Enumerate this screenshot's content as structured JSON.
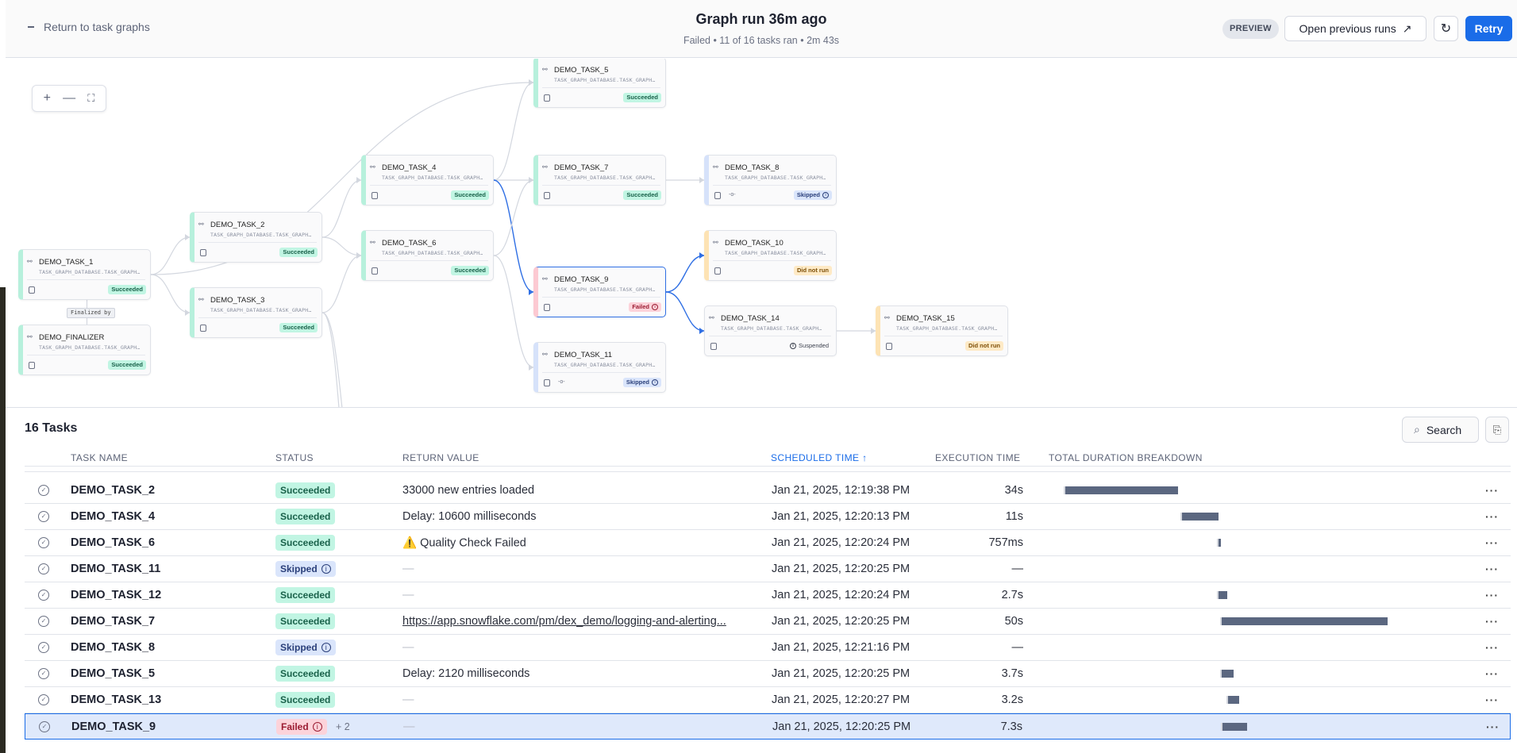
{
  "header": {
    "back_label": "Return to task graphs",
    "title": "Graph run 36m ago",
    "subtitle": "Failed • 11 of 16 tasks ran • 2m 43s",
    "preview_badge": "PREVIEW",
    "open_previous_runs": "Open previous runs",
    "retry": "Retry"
  },
  "graph": {
    "zoom_in": "+",
    "zoom_out": "—",
    "fit": "⛶",
    "finalized_by": "Finalized by",
    "subtitle": "TASK_GRAPH_DATABASE.TASK_GRAPH…",
    "nodes": [
      {
        "name": "DEMO_TASK_1",
        "status": "Succeeded",
        "kind": "succeeded"
      },
      {
        "name": "DEMO_FINALIZER",
        "status": "Succeeded",
        "kind": "succeeded"
      },
      {
        "name": "DEMO_TASK_2",
        "status": "Succeeded",
        "kind": "succeeded"
      },
      {
        "name": "DEMO_TASK_3",
        "status": "Succeeded",
        "kind": "succeeded"
      },
      {
        "name": "DEMO_TASK_4",
        "status": "Succeeded",
        "kind": "succeeded"
      },
      {
        "name": "DEMO_TASK_6",
        "status": "Succeeded",
        "kind": "succeeded"
      },
      {
        "name": "DEMO_TASK_5",
        "status": "Succeeded",
        "kind": "succeeded"
      },
      {
        "name": "DEMO_TASK_7",
        "status": "Succeeded",
        "kind": "succeeded"
      },
      {
        "name": "DEMO_TASK_9",
        "status": "Failed",
        "kind": "failed",
        "selected": true
      },
      {
        "name": "DEMO_TASK_11",
        "status": "Skipped",
        "kind": "skipped"
      },
      {
        "name": "DEMO_TASK_8",
        "status": "Skipped",
        "kind": "skipped"
      },
      {
        "name": "DEMO_TASK_10",
        "status": "Did not run",
        "kind": "didnotrun"
      },
      {
        "name": "DEMO_TASK_14",
        "status": "Suspended",
        "kind": "suspended"
      },
      {
        "name": "DEMO_TASK_15",
        "status": "Did not run",
        "kind": "didnotrun"
      }
    ],
    "edges": [
      [
        "DEMO_TASK_1",
        "DEMO_TASK_2"
      ],
      [
        "DEMO_TASK_1",
        "DEMO_TASK_3"
      ],
      [
        "DEMO_TASK_1",
        "DEMO_TASK_5"
      ],
      [
        "DEMO_TASK_2",
        "DEMO_TASK_4"
      ],
      [
        "DEMO_TASK_2",
        "DEMO_TASK_6"
      ],
      [
        "DEMO_TASK_3",
        "DEMO_TASK_6"
      ],
      [
        "DEMO_TASK_3",
        "DEMO_TASK_12"
      ],
      [
        "DEMO_TASK_3",
        "DEMO_TASK_13"
      ],
      [
        "DEMO_TASK_4",
        "DEMO_TASK_5"
      ],
      [
        "DEMO_TASK_4",
        "DEMO_TASK_7"
      ],
      [
        "DEMO_TASK_4",
        "DEMO_TASK_9"
      ],
      [
        "DEMO_TASK_6",
        "DEMO_TASK_7"
      ],
      [
        "DEMO_TASK_6",
        "DEMO_TASK_11"
      ],
      [
        "DEMO_TASK_7",
        "DEMO_TASK_8"
      ],
      [
        "DEMO_TASK_9",
        "DEMO_TASK_10"
      ],
      [
        "DEMO_TASK_9",
        "DEMO_TASK_14"
      ],
      [
        "DEMO_TASK_14",
        "DEMO_TASK_15"
      ]
    ],
    "highlighted_edges": [
      [
        "DEMO_TASK_4",
        "DEMO_TASK_9"
      ],
      [
        "DEMO_TASK_9",
        "DEMO_TASK_10"
      ],
      [
        "DEMO_TASK_9",
        "DEMO_TASK_14"
      ]
    ],
    "colors": {
      "edge": "#d3d7df",
      "highlight": "#2f6fe4"
    }
  },
  "tasks": {
    "title": "16 Tasks",
    "search": "Search",
    "columns": {
      "name": "TASK NAME",
      "status": "STATUS",
      "return": "RETURN VALUE",
      "scheduled": "SCHEDULED TIME",
      "execution": "EXECUTION TIME",
      "duration": "TOTAL DURATION BREAKDOWN"
    },
    "sort_column": "scheduled",
    "sort_direction": "ascending",
    "rows": [
      {
        "name": "DEMO_TASK_2",
        "status": "Succeeded",
        "kind": "succeeded",
        "return": "33000 new entries loaded",
        "scheduled": "Jan 21, 2025, 12:19:38 PM",
        "exec": "34s"
      },
      {
        "name": "DEMO_TASK_4",
        "status": "Succeeded",
        "kind": "succeeded",
        "return": "Delay: 10600 milliseconds",
        "scheduled": "Jan 21, 2025, 12:20:13 PM",
        "exec": "11s"
      },
      {
        "name": "DEMO_TASK_6",
        "status": "Succeeded",
        "kind": "succeeded",
        "return": "Quality Check Failed",
        "warning": true,
        "scheduled": "Jan 21, 2025, 12:20:24 PM",
        "exec": "757ms"
      },
      {
        "name": "DEMO_TASK_11",
        "status": "Skipped",
        "kind": "skipped",
        "return": "—",
        "scheduled": "Jan 21, 2025, 12:20:25 PM",
        "exec": "—"
      },
      {
        "name": "DEMO_TASK_12",
        "status": "Succeeded",
        "kind": "succeeded",
        "return": "—",
        "scheduled": "Jan 21, 2025, 12:20:24 PM",
        "exec": "2.7s"
      },
      {
        "name": "DEMO_TASK_7",
        "status": "Succeeded",
        "kind": "succeeded",
        "return": "https://app.snowflake.com/pm/dex_demo/logging-and-alerting...",
        "link": true,
        "scheduled": "Jan 21, 2025, 12:20:25 PM",
        "exec": "50s"
      },
      {
        "name": "DEMO_TASK_8",
        "status": "Skipped",
        "kind": "skipped",
        "return": "—",
        "scheduled": "Jan 21, 2025, 12:21:16 PM",
        "exec": "—"
      },
      {
        "name": "DEMO_TASK_5",
        "status": "Succeeded",
        "kind": "succeeded",
        "return": "Delay: 2120 milliseconds",
        "scheduled": "Jan 21, 2025, 12:20:25 PM",
        "exec": "3.7s"
      },
      {
        "name": "DEMO_TASK_13",
        "status": "Succeeded",
        "kind": "succeeded",
        "return": "—",
        "scheduled": "Jan 21, 2025, 12:20:27 PM",
        "exec": "3.2s"
      },
      {
        "name": "DEMO_TASK_9",
        "status": "Failed",
        "kind": "failed",
        "extra": "+ 2",
        "return": "—",
        "scheduled": "Jan 21, 2025, 12:20:25 PM",
        "exec": "7.3s",
        "selected": true
      }
    ]
  }
}
